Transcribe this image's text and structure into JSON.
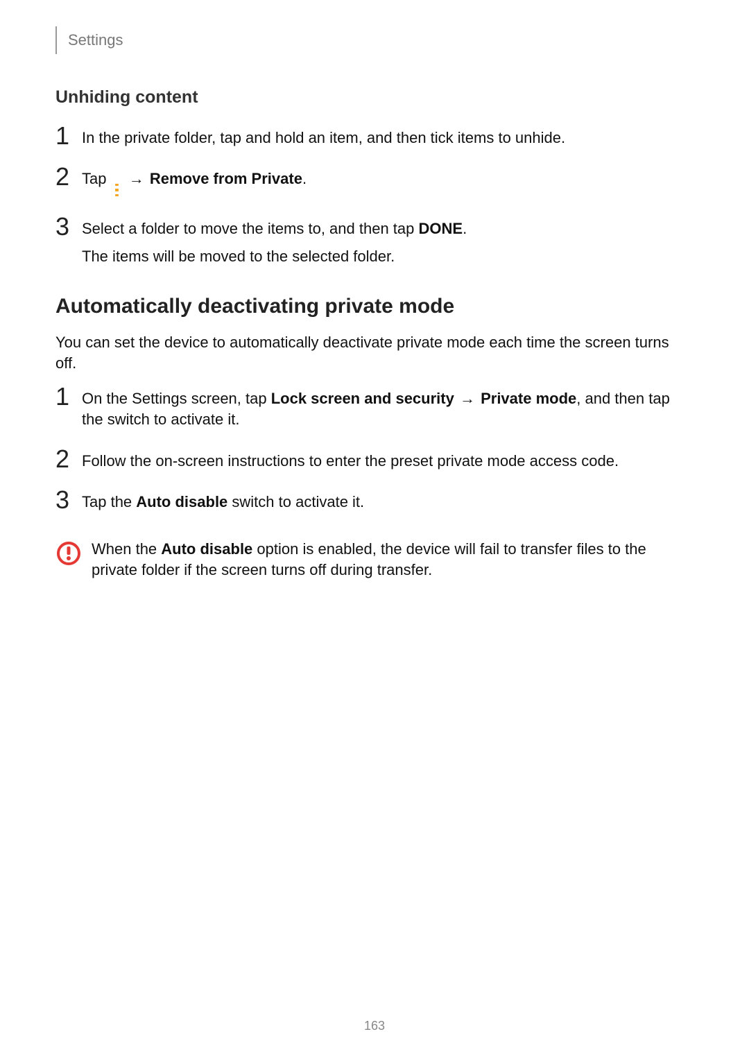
{
  "header": {
    "label": "Settings"
  },
  "section1": {
    "title": "Unhiding content",
    "steps": [
      {
        "text": "In the private folder, tap and hold an item, and then tick items to unhide."
      },
      {
        "prefix": "Tap ",
        "icon": "more-options-icon",
        "arrow": " → ",
        "bold": "Remove from Private",
        "suffix": "."
      },
      {
        "line1_pre": "Select a folder to move the items to, and then tap ",
        "line1_bold": "DONE",
        "line1_post": ".",
        "line2": "The items will be moved to the selected folder."
      }
    ]
  },
  "section2": {
    "title": "Automatically deactivating private mode",
    "intro": "You can set the device to automatically deactivate private mode each time the screen turns off.",
    "steps": [
      {
        "pre": "On the Settings screen, tap ",
        "bold1": "Lock screen and security",
        "arrow": " → ",
        "bold2": "Private mode",
        "post": ", and then tap the switch to activate it."
      },
      {
        "text": "Follow the on-screen instructions to enter the preset private mode access code."
      },
      {
        "pre": "Tap the ",
        "bold": "Auto disable",
        "post": " switch to activate it."
      }
    ],
    "note": {
      "pre": "When the ",
      "bold": "Auto disable",
      "post": " option is enabled, the device will fail to transfer files to the private folder if the screen turns off during transfer."
    }
  },
  "pageNumber": "163"
}
